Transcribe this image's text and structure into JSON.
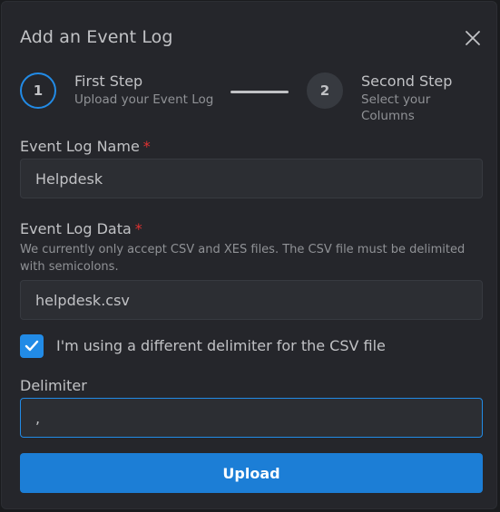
{
  "modal": {
    "title": "Add an Event Log",
    "close_icon": "close-icon"
  },
  "stepper": {
    "steps": [
      {
        "number": "1",
        "label": "First Step",
        "description": "Upload your Event Log",
        "active": true
      },
      {
        "number": "2",
        "label": "Second Step",
        "description": "Select your Columns",
        "active": false
      }
    ]
  },
  "form": {
    "name": {
      "label": "Event Log Name",
      "required_mark": "*",
      "value": "Helpdesk"
    },
    "data": {
      "label": "Event Log Data",
      "required_mark": "*",
      "description": "We currently only accept CSV and XES files. The CSV file must be delimited with semicolons.",
      "value": "helpdesk.csv"
    },
    "custom_delimiter": {
      "label": "I'm using a different delimiter for the CSV file",
      "checked": true
    },
    "delimiter": {
      "label": "Delimiter",
      "value": ","
    },
    "submit_label": "Upload"
  },
  "colors": {
    "accent": "#228be6",
    "button": "#1c7ed6",
    "required": "#e03131",
    "background": "#25262b"
  }
}
